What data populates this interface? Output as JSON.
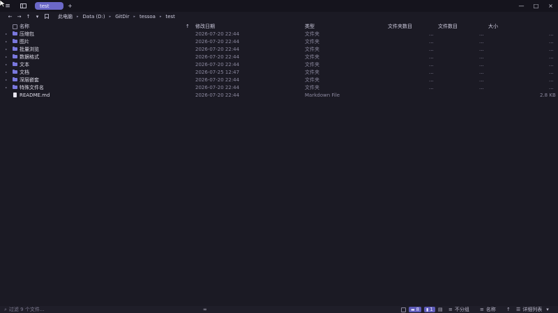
{
  "titlebar": {
    "tab_active": "test",
    "tab_add": "+",
    "controls": {
      "minimize": "—",
      "maximize": "□",
      "close": "×"
    }
  },
  "nav": {
    "back": "←",
    "forward": "→",
    "up": "↑",
    "dropdown": "▾",
    "bookmark": "⌑",
    "breadcrumbs": [
      "此电脑",
      "Data (D:)",
      "GitDir",
      "tessoa",
      "test"
    ],
    "separator": "▸"
  },
  "columns": {
    "name": "名称",
    "sort_arrow": "↑",
    "modified": "修改日期",
    "type": "类型",
    "folder_count": "文件夹数目",
    "file_count": "文件数目",
    "size": "大小"
  },
  "files": [
    {
      "name": "压缩包",
      "modified": "2026-07-20 22:44",
      "type": "文件夹",
      "folders": "...",
      "files": "...",
      "size": "...",
      "kind": "folder"
    },
    {
      "name": "图片",
      "modified": "2026-07-20 22:44",
      "type": "文件夹",
      "folders": "...",
      "files": "...",
      "size": "...",
      "kind": "folder"
    },
    {
      "name": "批量浏览",
      "modified": "2026-07-20 22:44",
      "type": "文件夹",
      "folders": "...",
      "files": "...",
      "size": "...",
      "kind": "folder"
    },
    {
      "name": "数据格式",
      "modified": "2026-07-20 22:44",
      "type": "文件夹",
      "folders": "...",
      "files": "...",
      "size": "...",
      "kind": "folder"
    },
    {
      "name": "文本",
      "modified": "2026-07-20 22:44",
      "type": "文件夹",
      "folders": "...",
      "files": "...",
      "size": "...",
      "kind": "folder"
    },
    {
      "name": "文档",
      "modified": "2026-07-25 12:47",
      "type": "文件夹",
      "folders": "...",
      "files": "...",
      "size": "...",
      "kind": "folder"
    },
    {
      "name": "深层嵌套",
      "modified": "2026-07-20 22:44",
      "type": "文件夹",
      "folders": "...",
      "files": "...",
      "size": "...",
      "kind": "folder"
    },
    {
      "name": "特殊文件名",
      "modified": "2026-07-20 22:44",
      "type": "文件夹",
      "folders": "...",
      "files": "...",
      "size": "...",
      "kind": "folder"
    },
    {
      "name": "README.md",
      "modified": "2026-07-20 22:44",
      "type": "Markdown File",
      "folders": "",
      "files": "",
      "size": "2.8 KB",
      "kind": "file"
    }
  ],
  "status": {
    "filter_placeholder": "过滤 9 个文件...",
    "filter_mode": "∞",
    "folder_count": "8",
    "file_count": "1",
    "group_label": "不分组",
    "sort_label": "名称",
    "sort_dir": "↑",
    "view_label": "详细列表",
    "view_caret": "▾"
  },
  "colors": {
    "accent": "#6b68c8",
    "background": "#1b1a24",
    "folder_icon": "#7a78de"
  }
}
